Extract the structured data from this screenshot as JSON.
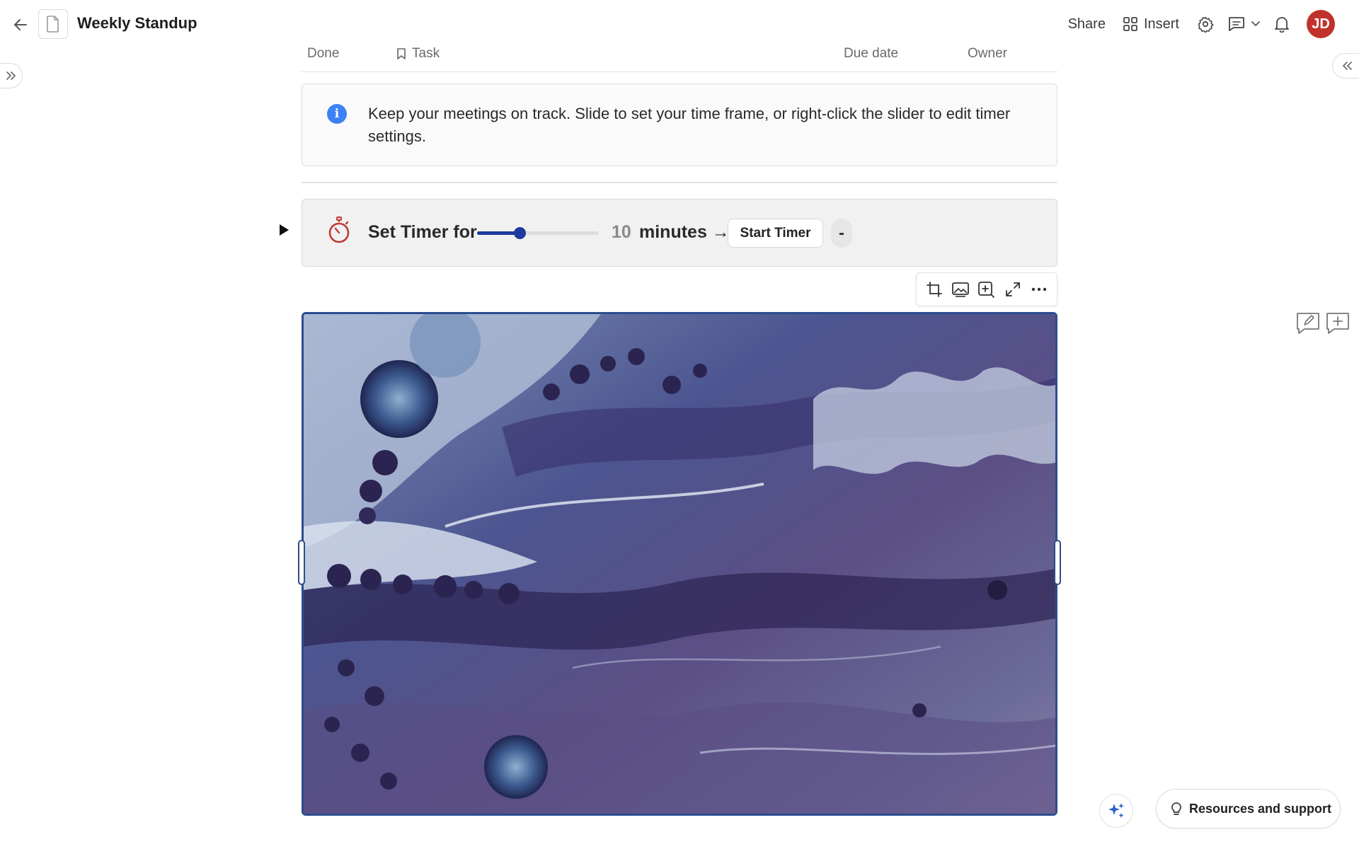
{
  "header": {
    "title": "Weekly Standup",
    "share_label": "Share",
    "insert_label": "Insert",
    "avatar_initials": "JD",
    "avatar_color": "#c0322b"
  },
  "table": {
    "columns": [
      "Done",
      "Task",
      "Due date",
      "Owner"
    ]
  },
  "callout": {
    "icon": "info-icon",
    "text": "Keep your meetings on track. Slide to set your time frame, or right-click the slider to edit timer settings."
  },
  "timer": {
    "label": "Set Timer for",
    "slider_fraction": 0.35,
    "value": "10",
    "unit": "minutes →",
    "start_label": "Start Timer",
    "minus_label": "-",
    "accent_color": "#1e3a9f"
  },
  "image_toolbar": {
    "buttons": [
      "crop-icon",
      "replace-image-icon",
      "zoom-in-icon",
      "fullscreen-icon",
      "more-icon"
    ]
  },
  "image": {
    "description_icon": "abstract-fluid-art-image",
    "frame_color": "#2b4d8f"
  },
  "footer": {
    "resources_label": "Resources and support"
  }
}
